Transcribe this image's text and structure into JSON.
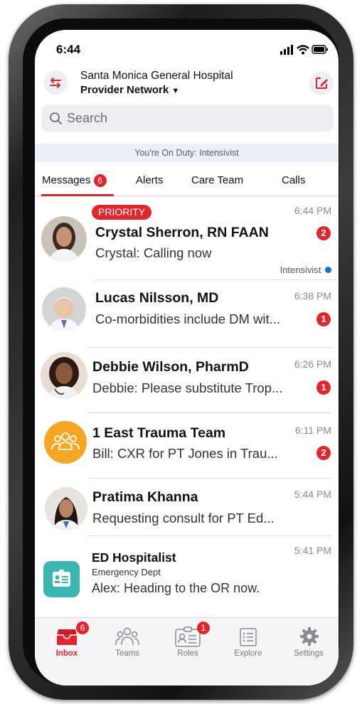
{
  "status": {
    "time": "6:44"
  },
  "header": {
    "org": "Santa Monica General Hospital",
    "network": "Provider Network"
  },
  "search": {
    "placeholder": "Search"
  },
  "duty_banner": "You're On Duty: Intensivist",
  "tabs": [
    {
      "label": "Messages",
      "badge": "6",
      "selected": true
    },
    {
      "label": "Alerts"
    },
    {
      "label": "Care Team"
    },
    {
      "label": "Calls"
    }
  ],
  "conversations": [
    {
      "tag": "PRIORITY",
      "name": "Crystal Sherron, RN FAAN",
      "message": "Crystal: Calling now",
      "time": "6:44 PM",
      "unread": "2",
      "role": "Intensivist"
    },
    {
      "name": "Lucas Nilsson, MD",
      "message": "Co-morbidities include DM wit...",
      "time": "6:38 PM",
      "unread": "1"
    },
    {
      "name": "Debbie Wilson, PharmD",
      "message": "Debbie: Please substitute Trop...",
      "time": "6:26 PM",
      "unread": "1"
    },
    {
      "name": "1 East Trauma Team",
      "message": "Bill: CXR for PT Jones in Trau...",
      "time": "6:11 PM",
      "unread": "2"
    },
    {
      "name": "Pratima Khanna",
      "message": "Requesting consult for PT Ed...",
      "time": "5:44 PM"
    },
    {
      "name": "ED Hospitalist",
      "subtitle": "Emergency Dept",
      "message": "Alex: Heading to the OR now.",
      "time": "5:41 PM"
    }
  ],
  "bottom_nav": [
    {
      "label": "Inbox",
      "badge": "6",
      "icon": "inbox-icon",
      "active": true
    },
    {
      "label": "Teams",
      "icon": "teams-icon"
    },
    {
      "label": "Roles",
      "badge": "1",
      "icon": "roles-icon"
    },
    {
      "label": "Explore",
      "icon": "explore-icon"
    },
    {
      "label": "Settings",
      "icon": "gear-icon"
    }
  ],
  "colors": {
    "accent": "#e1262d",
    "team_orange": "#f5a623",
    "hospitalist_teal": "#3bb5b0",
    "status_blue": "#1a6fd6"
  }
}
